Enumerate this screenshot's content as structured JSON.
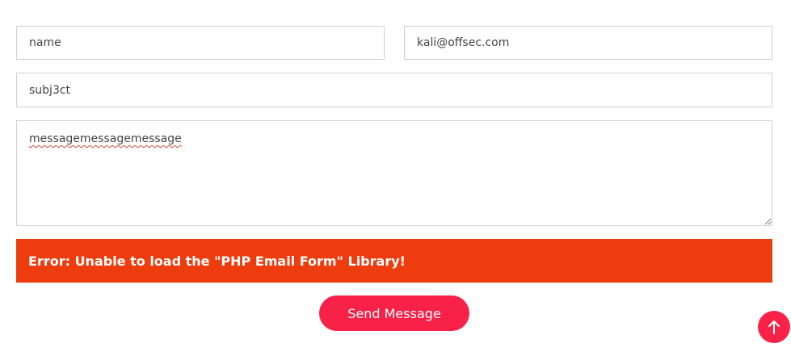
{
  "form": {
    "name_value": "name",
    "email_value": "kali@offsec.com",
    "subject_value": "subj3ct",
    "message_value": "messagemessagemessage",
    "error_text": "Error: Unable to load the \"PHP Email Form\" Library!",
    "send_label": "Send Message"
  },
  "icons": {
    "back_to_top": "arrow-up-icon"
  },
  "colors": {
    "error_bg": "#ed3c0d",
    "accent": "#f82249"
  }
}
